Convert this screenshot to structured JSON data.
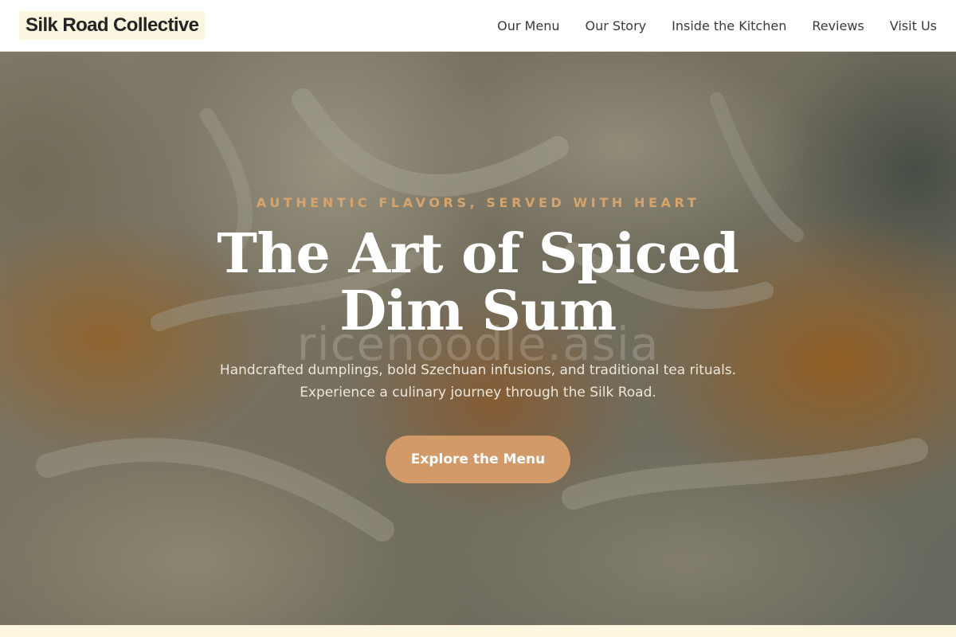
{
  "brand": {
    "name": "Silk Road Collective"
  },
  "nav": {
    "items": [
      {
        "label": "Our Menu"
      },
      {
        "label": "Our Story"
      },
      {
        "label": "Inside the Kitchen"
      },
      {
        "label": "Reviews"
      },
      {
        "label": "Visit Us"
      }
    ]
  },
  "hero": {
    "eyebrow": "AUTHENTIC FLAVORS, SERVED WITH HEART",
    "title": "The Art of Spiced Dim Sum",
    "watermark": "ricenoodle.asia",
    "subtitle": "Handcrafted dumplings, bold Szechuan infusions, and traditional tea rituals. Experience a culinary journey through the Silk Road.",
    "cta_label": "Explore the Menu",
    "background_image": "dumpling-closeup-photo"
  },
  "colors": {
    "accent": "#d19a68",
    "eyebrow": "#d7a46e",
    "brand_bg": "#fbf6df",
    "page_bg": "#fffbe9"
  }
}
